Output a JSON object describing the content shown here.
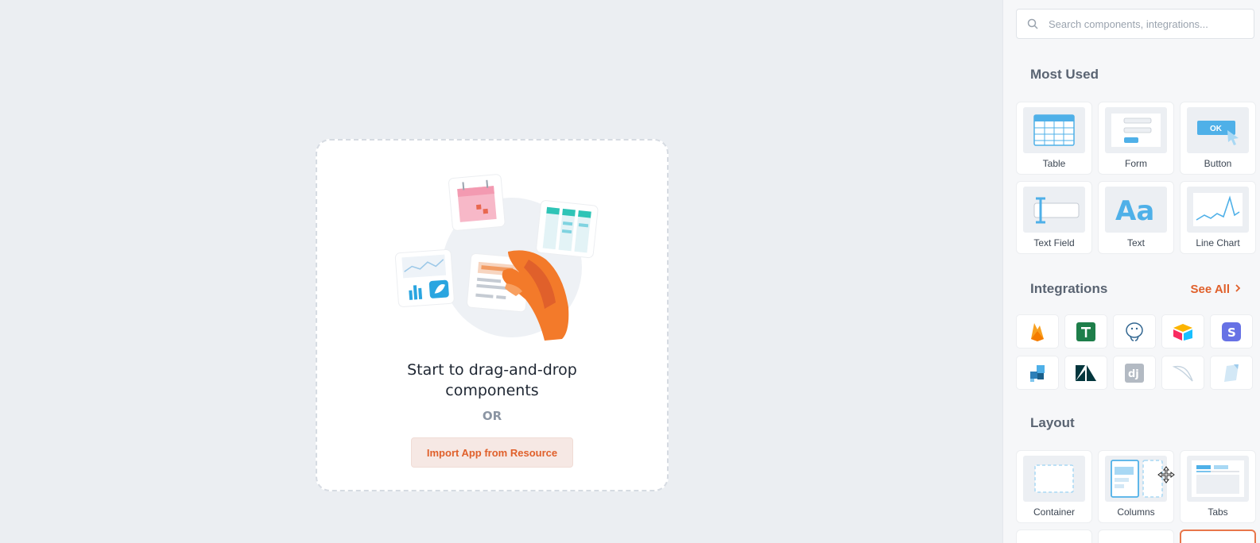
{
  "canvas": {
    "drop_title_line1": "Start to drag-and-drop",
    "drop_title_line2": "components",
    "or_text": "OR",
    "import_button": "Import App from Resource"
  },
  "sidebar": {
    "search": {
      "placeholder": "Search components, integrations..."
    },
    "most_used": {
      "title": "Most Used",
      "items": [
        {
          "label": "Table",
          "icon": "table-icon"
        },
        {
          "label": "Form",
          "icon": "form-icon"
        },
        {
          "label": "Button",
          "icon": "button-icon"
        },
        {
          "label": "Text Field",
          "icon": "text-field-icon"
        },
        {
          "label": "Text",
          "icon": "text-icon"
        },
        {
          "label": "Line Chart",
          "icon": "line-chart-icon"
        }
      ]
    },
    "integrations": {
      "title": "Integrations",
      "see_all": "See All",
      "items": [
        "firebase",
        "google-sheets",
        "postgresql",
        "airtable",
        "stripe",
        "datastore",
        "zendesk",
        "django",
        "mysql",
        "docs"
      ]
    },
    "layout": {
      "title": "Layout",
      "items": [
        {
          "label": "Container",
          "icon": "container-icon"
        },
        {
          "label": "Columns",
          "icon": "columns-icon"
        },
        {
          "label": "Tabs",
          "icon": "tabs-icon"
        }
      ]
    }
  },
  "colors": {
    "accent": "#e0602b",
    "blue": "#4fb0e8",
    "bg": "#ebeef2"
  }
}
